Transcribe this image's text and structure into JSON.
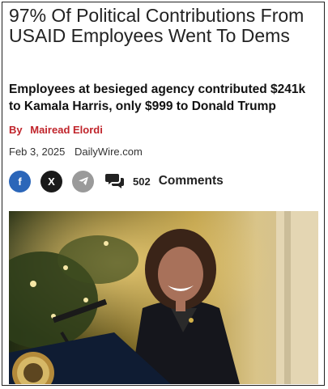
{
  "article": {
    "headline": "97% Of Political Contributions From USAID Employees Went To Dems",
    "subheadline": "Employees at besieged agency contributed $241k to Kamala Harris, only $999 to Donald Trump",
    "byline_prefix": "By",
    "author": "Mairead Elordi",
    "date": "Feb 3, 2025",
    "source": "DailyWire.com"
  },
  "share": {
    "facebook_icon": "f",
    "x_icon": "X",
    "telegram_icon": "paper-plane",
    "comment_count": "502",
    "comments_label": "Comments"
  },
  "colors": {
    "byline": "#c0242b",
    "facebook": "#2b66b9",
    "x": "#1a1a1a",
    "telegram": "#9a9a9a"
  }
}
